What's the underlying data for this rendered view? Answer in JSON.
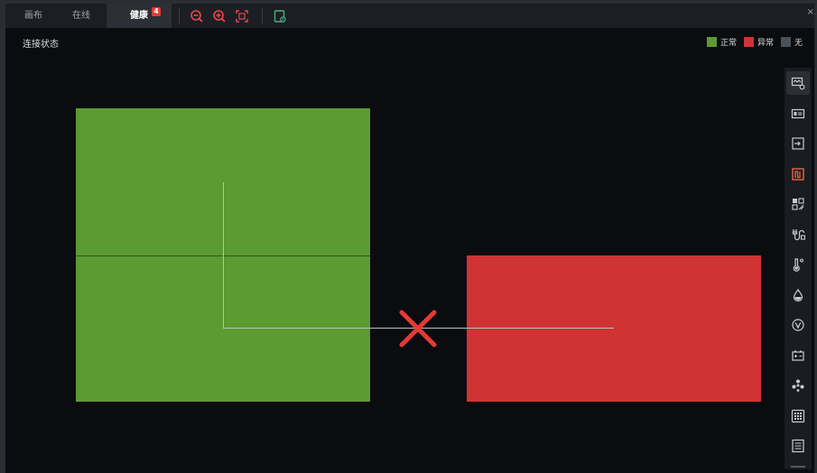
{
  "toolbar": {
    "tabs": [
      {
        "label": "画布"
      },
      {
        "label": "在线"
      },
      {
        "label": "健康",
        "badge": "4"
      }
    ],
    "buttons": [
      "zoom-out-icon",
      "zoom-in-icon",
      "fit-screen-icon",
      "export-icon"
    ],
    "accent": "#e5484d",
    "export_color": "#4caf7a"
  },
  "status": {
    "title": "连接状态"
  },
  "legend": [
    {
      "label": "正常",
      "color": "#5c9a32"
    },
    {
      "label": "异常",
      "color": "#cf3334"
    },
    {
      "label": "无",
      "color": "#4a5058"
    }
  ],
  "diagram": {
    "nodes": [
      {
        "status": "normal",
        "color": "#5c9a32"
      },
      {
        "status": "abnormal",
        "color": "#cf3334"
      }
    ],
    "link": {
      "state": "broken",
      "marker_color": "#e53935"
    }
  },
  "side_panel": {
    "items": [
      "monitor-settings-icon",
      "screen-icon",
      "input-icon",
      "signal-icon",
      "qr-code-icon",
      "cable-icon",
      "temperature-icon",
      "humidity-icon",
      "voltage-icon",
      "battery-icon",
      "fan-icon",
      "keypad-icon",
      "list-icon"
    ],
    "active_color": "#e8663c"
  }
}
